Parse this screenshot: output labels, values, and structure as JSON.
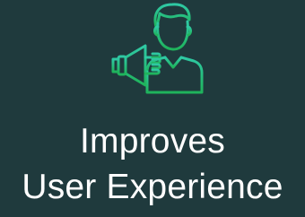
{
  "tile": {
    "icon": "person-with-megaphone-icon",
    "line1": "Improves",
    "line2": "User Experience"
  },
  "colors": {
    "background": "#1f3a3d",
    "icon_gradient_top": "#2fc9a4",
    "icon_gradient_bottom": "#1fb35b",
    "text": "#ffffff"
  }
}
